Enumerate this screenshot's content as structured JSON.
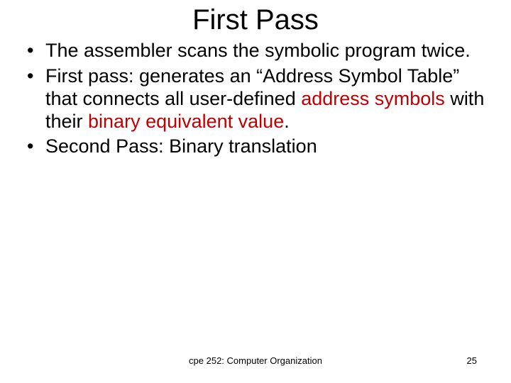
{
  "title": "First Pass",
  "bullets": {
    "b1": "The assembler scans the symbolic program twice.",
    "b2": {
      "p1": "First pass: generates an “Address Symbol Table” that connects all user-defined ",
      "hl1": "address symbols",
      "p2": " with their ",
      "hl2": "binary equivalent value",
      "p3": "."
    },
    "b3": "Second Pass: Binary translation"
  },
  "footer": {
    "course": "cpe 252: Computer Organization",
    "page": "25"
  }
}
